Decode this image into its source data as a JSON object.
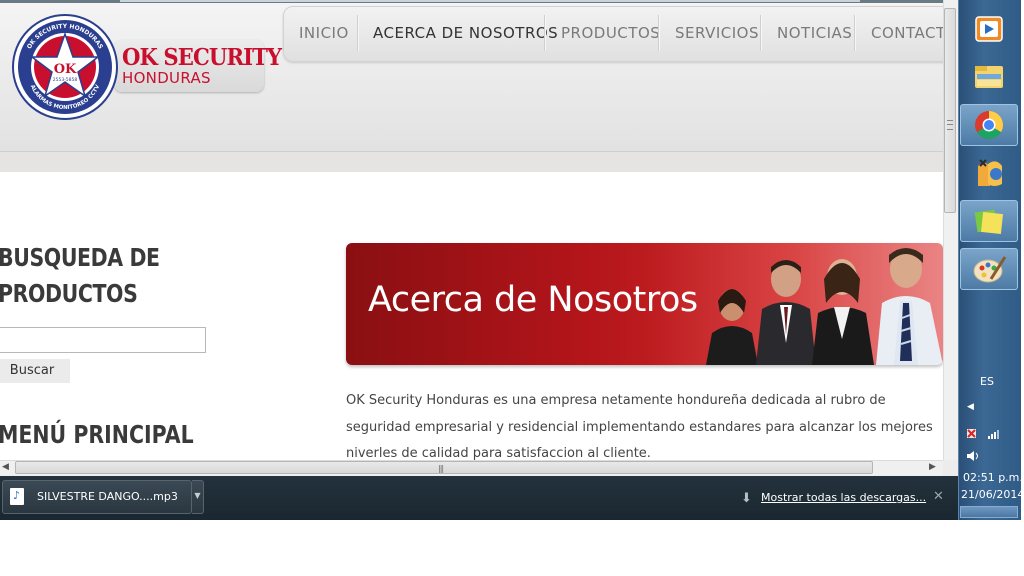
{
  "site": {
    "logo": {
      "title": "OK SECURITY",
      "subtitle": "HONDURAS",
      "badge_center": "OK",
      "badge_phone": "2553-5858",
      "badge_top": "OK SECURITY HONDURAS",
      "badge_bottom": "ALARMAS MONITOREO CCTV"
    },
    "nav": {
      "items": [
        {
          "label": "INICIO"
        },
        {
          "label": "ACERCA DE NOSOTROS"
        },
        {
          "label": "PRODUCTOS"
        },
        {
          "label": "SERVICIOS"
        },
        {
          "label": "NOTICIAS"
        },
        {
          "label": "CONTACTE"
        }
      ],
      "active_index": 1
    },
    "sidebar": {
      "search_heading": "BUSQUEDA DE PRODUCTOS",
      "search_value": "",
      "search_button": "Buscar",
      "menu_heading": "MENÚ PRINCIPAL"
    },
    "main": {
      "banner_title": "Acerca de Nosotros",
      "intro": "OK Security Honduras es una empresa netamente hondureña dedicada al rubro de seguridad empresarial y residencial implementando estandares para alcanzar los mejores niverles de calidad para satisfaccion al cliente."
    }
  },
  "browser": {
    "download_file": "SILVESTRE DANGO....mp3",
    "show_all_downloads": "Mostrar todas las descargas...",
    "close_symbol": "✕"
  },
  "taskbar": {
    "buttons": [
      {
        "icon": "media-player-icon",
        "active": false
      },
      {
        "icon": "file-explorer-icon",
        "active": false
      },
      {
        "icon": "chrome-icon",
        "active": true
      },
      {
        "icon": "games-icon",
        "active": false
      },
      {
        "icon": "sticky-notes-icon",
        "active": true
      },
      {
        "icon": "paint-icon",
        "active": true
      }
    ],
    "language": "ES",
    "time": "02:51 p.m.",
    "date": "21/06/2014"
  },
  "colors": {
    "brand_red": "#c8102e",
    "banner_red": "#b3151a",
    "taskbar_blue": "#3b6894",
    "download_bar": "#1f2d37"
  }
}
